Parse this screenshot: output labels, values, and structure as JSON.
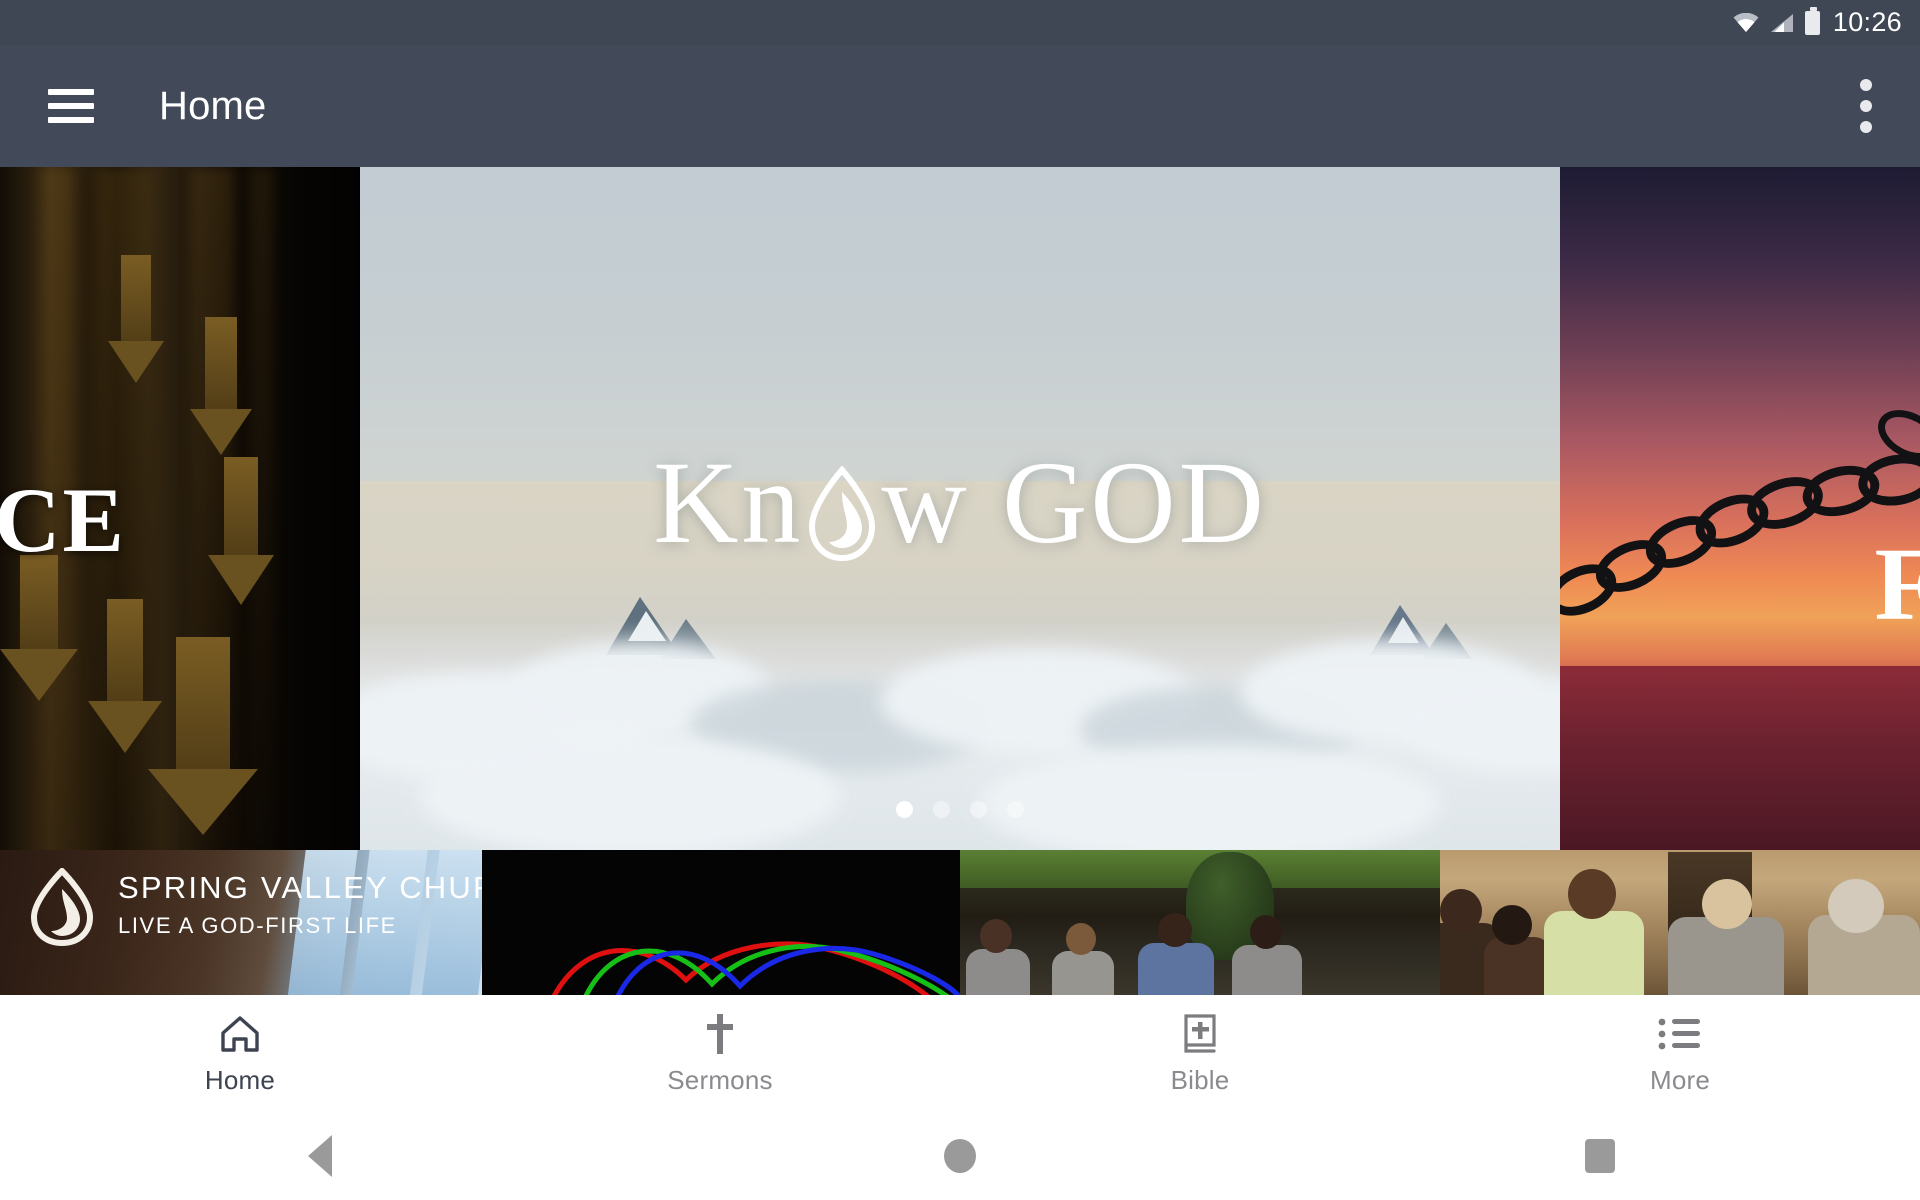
{
  "status_bar": {
    "time": "10:26",
    "icons": [
      "wifi-icon",
      "cellular-signal-icon",
      "battery-icon"
    ]
  },
  "app_bar": {
    "menu_icon": "hamburger-menu-icon",
    "title": "Home",
    "overflow_icon": "overflow-menu-icon"
  },
  "carousel": {
    "active_index": 0,
    "dot_count": 4,
    "slides": [
      {
        "id": "slide-grace",
        "visible_text": "CE",
        "description": "dark grunge background with gold descending arrows"
      },
      {
        "id": "slide-know-god",
        "title_part_1": "Kn",
        "title_part_2": "w GOD",
        "logo_icon": "flame-drop-logo-icon",
        "description": "mountain peaks above a sea of clouds at dawn"
      },
      {
        "id": "slide-free",
        "visible_text": "F",
        "description": "broken chain over sunset ocean"
      }
    ]
  },
  "thumbnails": [
    {
      "id": "thumb-spring-valley-church",
      "logo_icon": "flame-drop-logo-icon",
      "title": "SPRING VALLEY CHURCH",
      "subtitle": "LIVE A GOD-FIRST LIFE"
    },
    {
      "id": "thumb-laser-arcs",
      "title": "",
      "description": "red green and blue laser arcs on black"
    },
    {
      "id": "thumb-outdoor-group",
      "title": "",
      "description": "group of people seated outdoors on lawn"
    },
    {
      "id": "thumb-prayer-circle",
      "title": "",
      "description": "group of people praying with arms around each other"
    }
  ],
  "bottom_nav": {
    "items": [
      {
        "label": "Home",
        "icon": "home-icon",
        "active": true
      },
      {
        "label": "Sermons",
        "icon": "cross-icon",
        "active": false
      },
      {
        "label": "Bible",
        "icon": "bible-book-icon",
        "active": false
      },
      {
        "label": "More",
        "icon": "list-icon",
        "active": false
      }
    ]
  },
  "system_nav": {
    "back": "back-triangle-icon",
    "home": "home-circle-icon",
    "recents": "recents-square-icon"
  },
  "colors": {
    "app_bar": "#424a59",
    "status_bar": "#3f4654",
    "nav_active": "#3d4350",
    "nav_inactive": "#8b8b8f",
    "page_background": "#ffffff"
  }
}
